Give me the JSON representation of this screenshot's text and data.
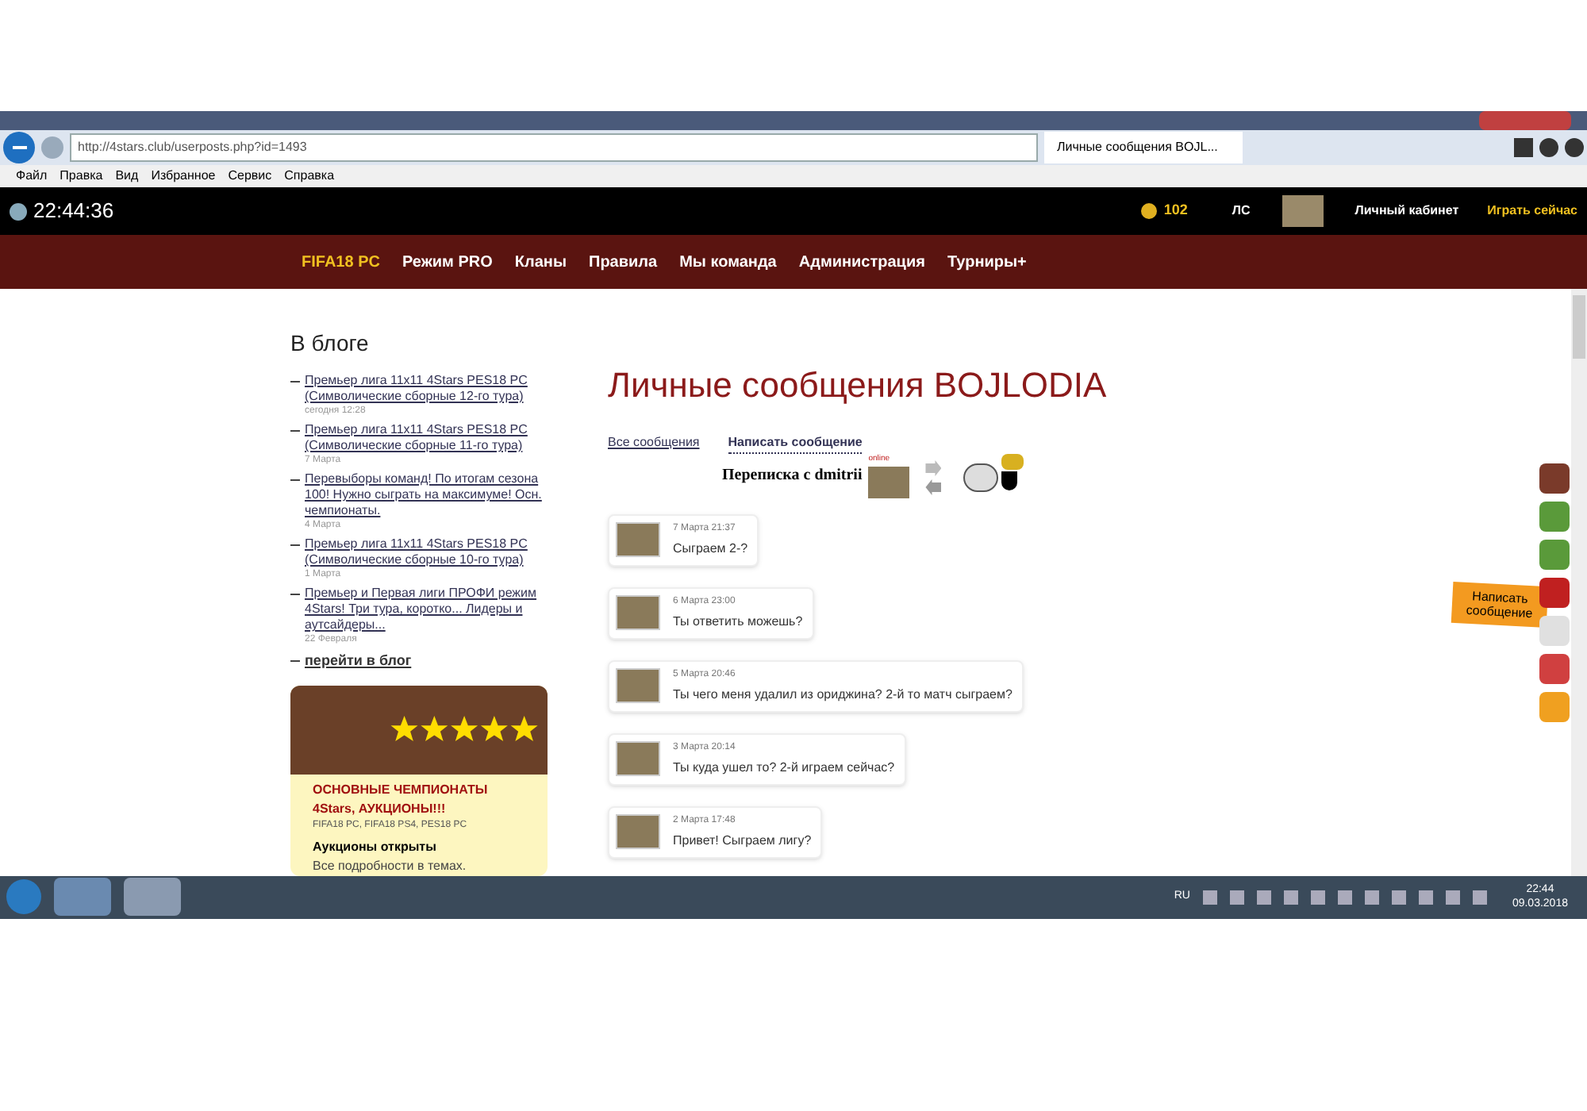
{
  "browser": {
    "address": "http://4stars.club/userposts.php?id=1493",
    "tab": {
      "title": "Личные сообщения BOJL...",
      "selected": true
    },
    "menu": [
      "Файл",
      "Правка",
      "Вид",
      "Избранное",
      "Сервис",
      "Справка"
    ]
  },
  "topbar": {
    "clock": "22:44:36",
    "coins": "102",
    "ls": "ЛС",
    "cabinet": "Личный кабинет",
    "play": "Играть сейчас"
  },
  "nav": [
    {
      "label": "FIFA18 PC",
      "selected": true
    },
    {
      "label": "Режим PRO",
      "selected": false
    },
    {
      "label": "Кланы",
      "selected": false
    },
    {
      "label": "Правила",
      "selected": false
    },
    {
      "label": "Мы команда",
      "selected": false
    },
    {
      "label": "Администрация",
      "selected": false
    },
    {
      "label": "Турниры+",
      "selected": false
    }
  ],
  "blog": {
    "title": "В блоге",
    "posts": [
      {
        "title": "Премьер лига 11x11 4Stars PES18 PC (Символические сборные 12-го тура)",
        "date": "сегодня 12:28"
      },
      {
        "title": "Премьер лига 11x11 4Stars PES18 PC (Символические сборные 11-го тура)",
        "date": "7 Марта"
      },
      {
        "title": "Перевыборы команд! По итогам сезона 100! Нужно сыграть на максимуме! Осн. чемпионаты.",
        "date": "4 Марта"
      },
      {
        "title": "Премьер лига 11x11 4Stars PES18 PC (Символические сборные 10-го тура)",
        "date": "1 Марта"
      },
      {
        "title": "Премьер и Первая лиги ПРОФИ режим 4Stars! Три тура, коротко... Лидеры и аутсайдеры...",
        "date": "22 Февраля"
      }
    ],
    "more": "перейти в блог"
  },
  "promo": {
    "title": "ОСНОВНЫЕ ЧЕМПИОНАТЫ 4Stars, АУКЦИОНЫ!!!",
    "platforms": "FIFA18 PC, FIFA18 PS4, PES18 PC",
    "heading": "Аукционы открыты",
    "text": "Все подробности в темах."
  },
  "page": {
    "title": "Личные сообщения BOJLODIA",
    "links": [
      "Все сообщения",
      "Написать сообщение"
    ],
    "conversation": "Переписка с dmitrii",
    "online": "online"
  },
  "messages": [
    {
      "date": "7 Марта 21:37",
      "text": "Сыграем 2-?"
    },
    {
      "date": "6 Марта 23:00",
      "text": "Ты ответить можешь?"
    },
    {
      "date": "5 Марта 20:46",
      "text": "Ты чего меня удалил из ориджина? 2-й то матч сыграем?"
    },
    {
      "date": "3 Марта 20:14",
      "text": "Ты куда ушел то? 2-й играем сейчас?"
    },
    {
      "date": "2 Марта 17:48",
      "text": "Привет! Сыграем лигу?"
    }
  ],
  "side_tab": "Написать сообщение",
  "taskbar": {
    "lang": "RU",
    "time": "22:44",
    "date": "09.03.2018"
  }
}
